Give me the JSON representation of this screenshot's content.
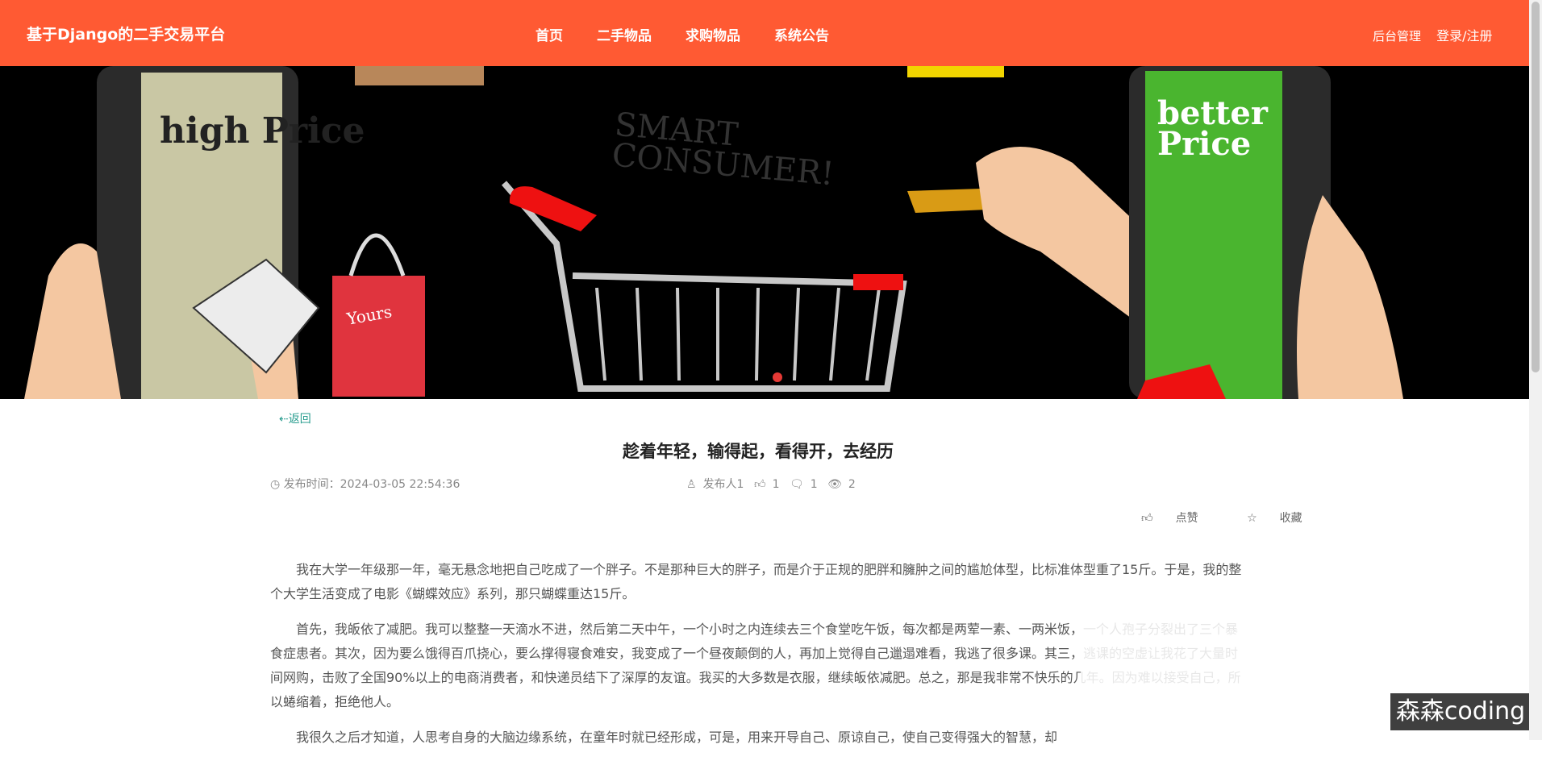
{
  "header": {
    "brand": "基于Django的二手交易平台",
    "nav": [
      "首页",
      "二手物品",
      "求购物品",
      "系统公告"
    ],
    "admin_label": "后台管理",
    "login_label": "登录/注册"
  },
  "banner": {
    "left_sign": "high Price",
    "right_sign": "better Price",
    "chalk_text": "SMART CONSUMER!",
    "bag_text": "Yours"
  },
  "article": {
    "back_label": "⇠返回",
    "title": "趁着年轻，输得起，看得开，去经历",
    "publish_time": "发布时间：2024-03-05 22:54:36",
    "author": "发布人1",
    "likes": "1",
    "comments": "1",
    "views": "2",
    "like_label": "点赞",
    "favorite_label": "收藏",
    "paragraphs": [
      "我在大学一年级那一年，毫无悬念地把自己吃成了一个胖子。不是那种巨大的胖子，而是介于正规的肥胖和臃肿之间的尴尬体型，比标准体型重了15斤。于是，我的整个大学生活变成了电影《蝴蝶效应》系列，那只蝴蝶重达15斤。",
      "首先，我皈依了减肥。我可以整整一天滴水不进，然后第二天中午，一个小时之内连续去三个食堂吃午饭，每次都是两荤一素、一两米饭，一个人孢子分裂出了三个暴食症患者。其次，因为要么饿得百爪挠心，要么撑得寝食难安，我变成了一个昼夜颠倒的人，再加上觉得自己邋遢难看，我逃了很多课。其三，逃课的空虚让我花了大量时间网购，击败了全国90%以上的电商消费者，和快递员结下了深厚的友谊。我买的大多数是衣服，继续皈依减肥。总之，那是我非常不快乐的几年。因为难以接受自己，所以蜷缩着，拒绝他人。",
      "我很久之后才知道，人思考自身的大脑边缘系统，在童年时就已经形成，可是，用来开导自己、原谅自己，使自己变得强大的智慧，却"
    ]
  },
  "watermark": "森森coding",
  "colors": {
    "header_bg": "#ff5a33",
    "link": "#2a9d8f"
  }
}
